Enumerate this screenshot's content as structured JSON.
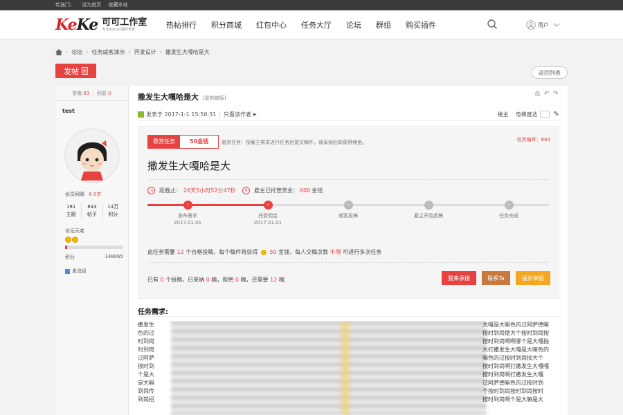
{
  "topbar": {
    "items": [
      "传送门：",
      "设为首页",
      "收藏本站"
    ]
  },
  "logo": {
    "mark_a": "Ke",
    "mark_b": "Ke",
    "cn": "可可工作室",
    "sub": "专注discuz!插件开发"
  },
  "nav": {
    "items": [
      "热帖排行",
      "积分商城",
      "红包中心",
      "任务大厅",
      "论坛",
      "群组",
      "购买插件"
    ]
  },
  "user": {
    "label": "用户"
  },
  "breadcrumb": {
    "items": [
      "论坛",
      "任务威客演示",
      "开发设计",
      "撒发生大嘎哈是大"
    ]
  },
  "buttons": {
    "post": "发帖",
    "back": "返回列表"
  },
  "sidebar": {
    "views_label": "查看: ",
    "views": "83",
    "replies_label": "回复: ",
    "replies": "0",
    "username": "test",
    "member_label": "会员网聊",
    "member_value": "6.9岁",
    "stats": [
      {
        "value": "191",
        "label": "主题"
      },
      {
        "value": "843",
        "label": "帖子"
      },
      {
        "value": "14万",
        "label": "积分"
      }
    ],
    "rank": "论坛元老",
    "progress": 0.03,
    "points_label": "积分",
    "points": "148065",
    "send_message": "发消息"
  },
  "post": {
    "title": "撒发生大嘎哈是大",
    "copy_link": "[复制链接]",
    "published": "发表于 2017-1-1 15:50:31",
    "author_only": "只看该作者",
    "floor": "楼主",
    "jump": "电梯直达"
  },
  "task": {
    "type_label": "悬赏任务",
    "amount": "50金钱",
    "desc": "悬赏任务：按雇主需求进行任务后提交稿件，被采纳后即获得佣金。",
    "task_no": "任务编号：664",
    "title": "撒发生大嘎哈是大",
    "deadline_label": "距截止：",
    "deadline_value": "26天5小时52分47秒",
    "escrow_label": "雇主已托管赏金：",
    "escrow_value": "600",
    "escrow_unit": "金钱",
    "steps": [
      {
        "label": "发布需求",
        "date": "2017.01.01",
        "done": true
      },
      {
        "label": "托管佣金",
        "date": "2017.01.01",
        "done": true
      },
      {
        "label": "威客投稿",
        "date": "",
        "done": false
      },
      {
        "label": "雇主开始选稿",
        "date": "",
        "done": false
      },
      {
        "label": "任务完成",
        "date": "",
        "done": false
      }
    ],
    "need_a": "此任务需要",
    "need_count": "12",
    "need_b": "个合格投稿，每个稿件将获得",
    "need_reward": "50",
    "need_c": "金钱，每人交稿次数",
    "need_limit": "不限",
    "need_d": "可进行多次任务",
    "sum_a": "已有",
    "sum_submitted": "0",
    "sum_b": "个投稿，已采纳",
    "sum_accepted": "0",
    "sum_c": "稿，拒绝",
    "sum_rejected": "0",
    "sum_d": "稿，还需要",
    "sum_remaining": "12",
    "sum_e": "稿",
    "actions": [
      "我来承接",
      "联系Ta",
      "投诉举报"
    ]
  },
  "requirements": {
    "title": "任务需求:",
    "left_lines": [
      "撒发生",
      "色的过",
      "时到岗",
      "时到岗",
      "过阿萨",
      "按时到",
      "个是大",
      "是大嘛",
      "到岗传",
      "到岗招"
    ],
    "right_lines": [
      "大嘎是大嘛色的过阿萨德嘛",
      "按时到岗使大个按时到岗按",
      "按时到岗啊啊哪个是大嘎指",
      "大打撒发生大嘎是大嘛色的",
      "嘛色的过按时到岗接大个",
      "按时到岗啊打撒发生大嘎嘎",
      "按时到岗啊打撒发生大嘎",
      "过阿萨德嘛色的过按时到",
      "个按时到岗按时到岗按时",
      "按时到岗啊个是大嘛是大"
    ]
  },
  "colors": {
    "accent": "#e64340",
    "brown": "#c8793e",
    "orange": "#f5a623",
    "gray_step": "#bbbbbb"
  }
}
